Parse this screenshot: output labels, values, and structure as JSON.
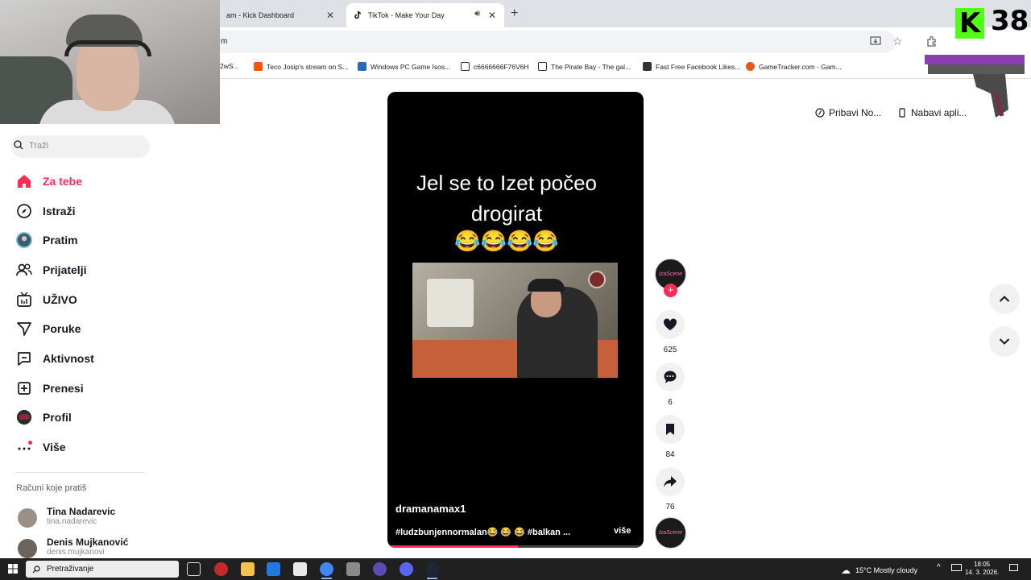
{
  "browser": {
    "tabs": [
      {
        "label": "am - Kick Dashboard"
      },
      {
        "label": "TikTok - Make Your Day"
      }
    ],
    "url": "m",
    "bookmarks": [
      {
        "label": "2wS..."
      },
      {
        "label": "Teco Josip's stream on S..."
      },
      {
        "label": "Windows PC Game Isos..."
      },
      {
        "label": "c6666666F76V6H"
      },
      {
        "label": "The Pirate Bay - The gal..."
      },
      {
        "label": "Fast Free Facebook Likes..."
      },
      {
        "label": "GameTracker.com - Gam..."
      }
    ]
  },
  "overlay": {
    "kick_logo": "K",
    "viewer_count": "38"
  },
  "sidebar": {
    "search_placeholder": "Traži",
    "items": [
      {
        "label": "Za tebe",
        "icon": "home-icon",
        "active": true
      },
      {
        "label": "Istraži",
        "icon": "compass-icon"
      },
      {
        "label": "Pratim",
        "icon": "avatar-icon"
      },
      {
        "label": "Prijatelji",
        "icon": "friends-icon"
      },
      {
        "label": "UŽIVO",
        "icon": "live-icon"
      },
      {
        "label": "Poruke",
        "icon": "send-icon"
      },
      {
        "label": "Aktivnost",
        "icon": "activity-icon"
      },
      {
        "label": "Prenesi",
        "icon": "upload-icon"
      },
      {
        "label": "Profil",
        "icon": "profile-icon"
      },
      {
        "label": "Više",
        "icon": "more-icon"
      }
    ],
    "following_title": "Računi koje pratiš",
    "accounts": [
      {
        "name": "Tina Nadarevic",
        "handle": "tina.nadarevic"
      },
      {
        "name": "Denis Mujkanović",
        "handle": "denis.mujkanovi"
      }
    ]
  },
  "video": {
    "caption_line1": "Jel se to Izet počeo",
    "caption_line2": "drogirat",
    "emojis": "😂😂😂😂",
    "author": "dramanamax1",
    "hashtags": "#ludzbunjennormalan😂 😂 😂  #balkan ...",
    "more_label": "više",
    "progress": 0.51
  },
  "actions": {
    "creator_badge": "IzaScene",
    "likes": "625",
    "comments": "6",
    "saves": "84",
    "shares": "76"
  },
  "top_right": {
    "get_coins": "Pribavi No...",
    "get_app": "Nabavi apli..."
  },
  "taskbar": {
    "search_placeholder": "Pretraživanje",
    "weather": "15°C  Mostly cloudy",
    "time": "18:05",
    "date": "14. 3. 2026."
  },
  "colors": {
    "accent": "#fe2c55",
    "kick": "#53fc18"
  }
}
